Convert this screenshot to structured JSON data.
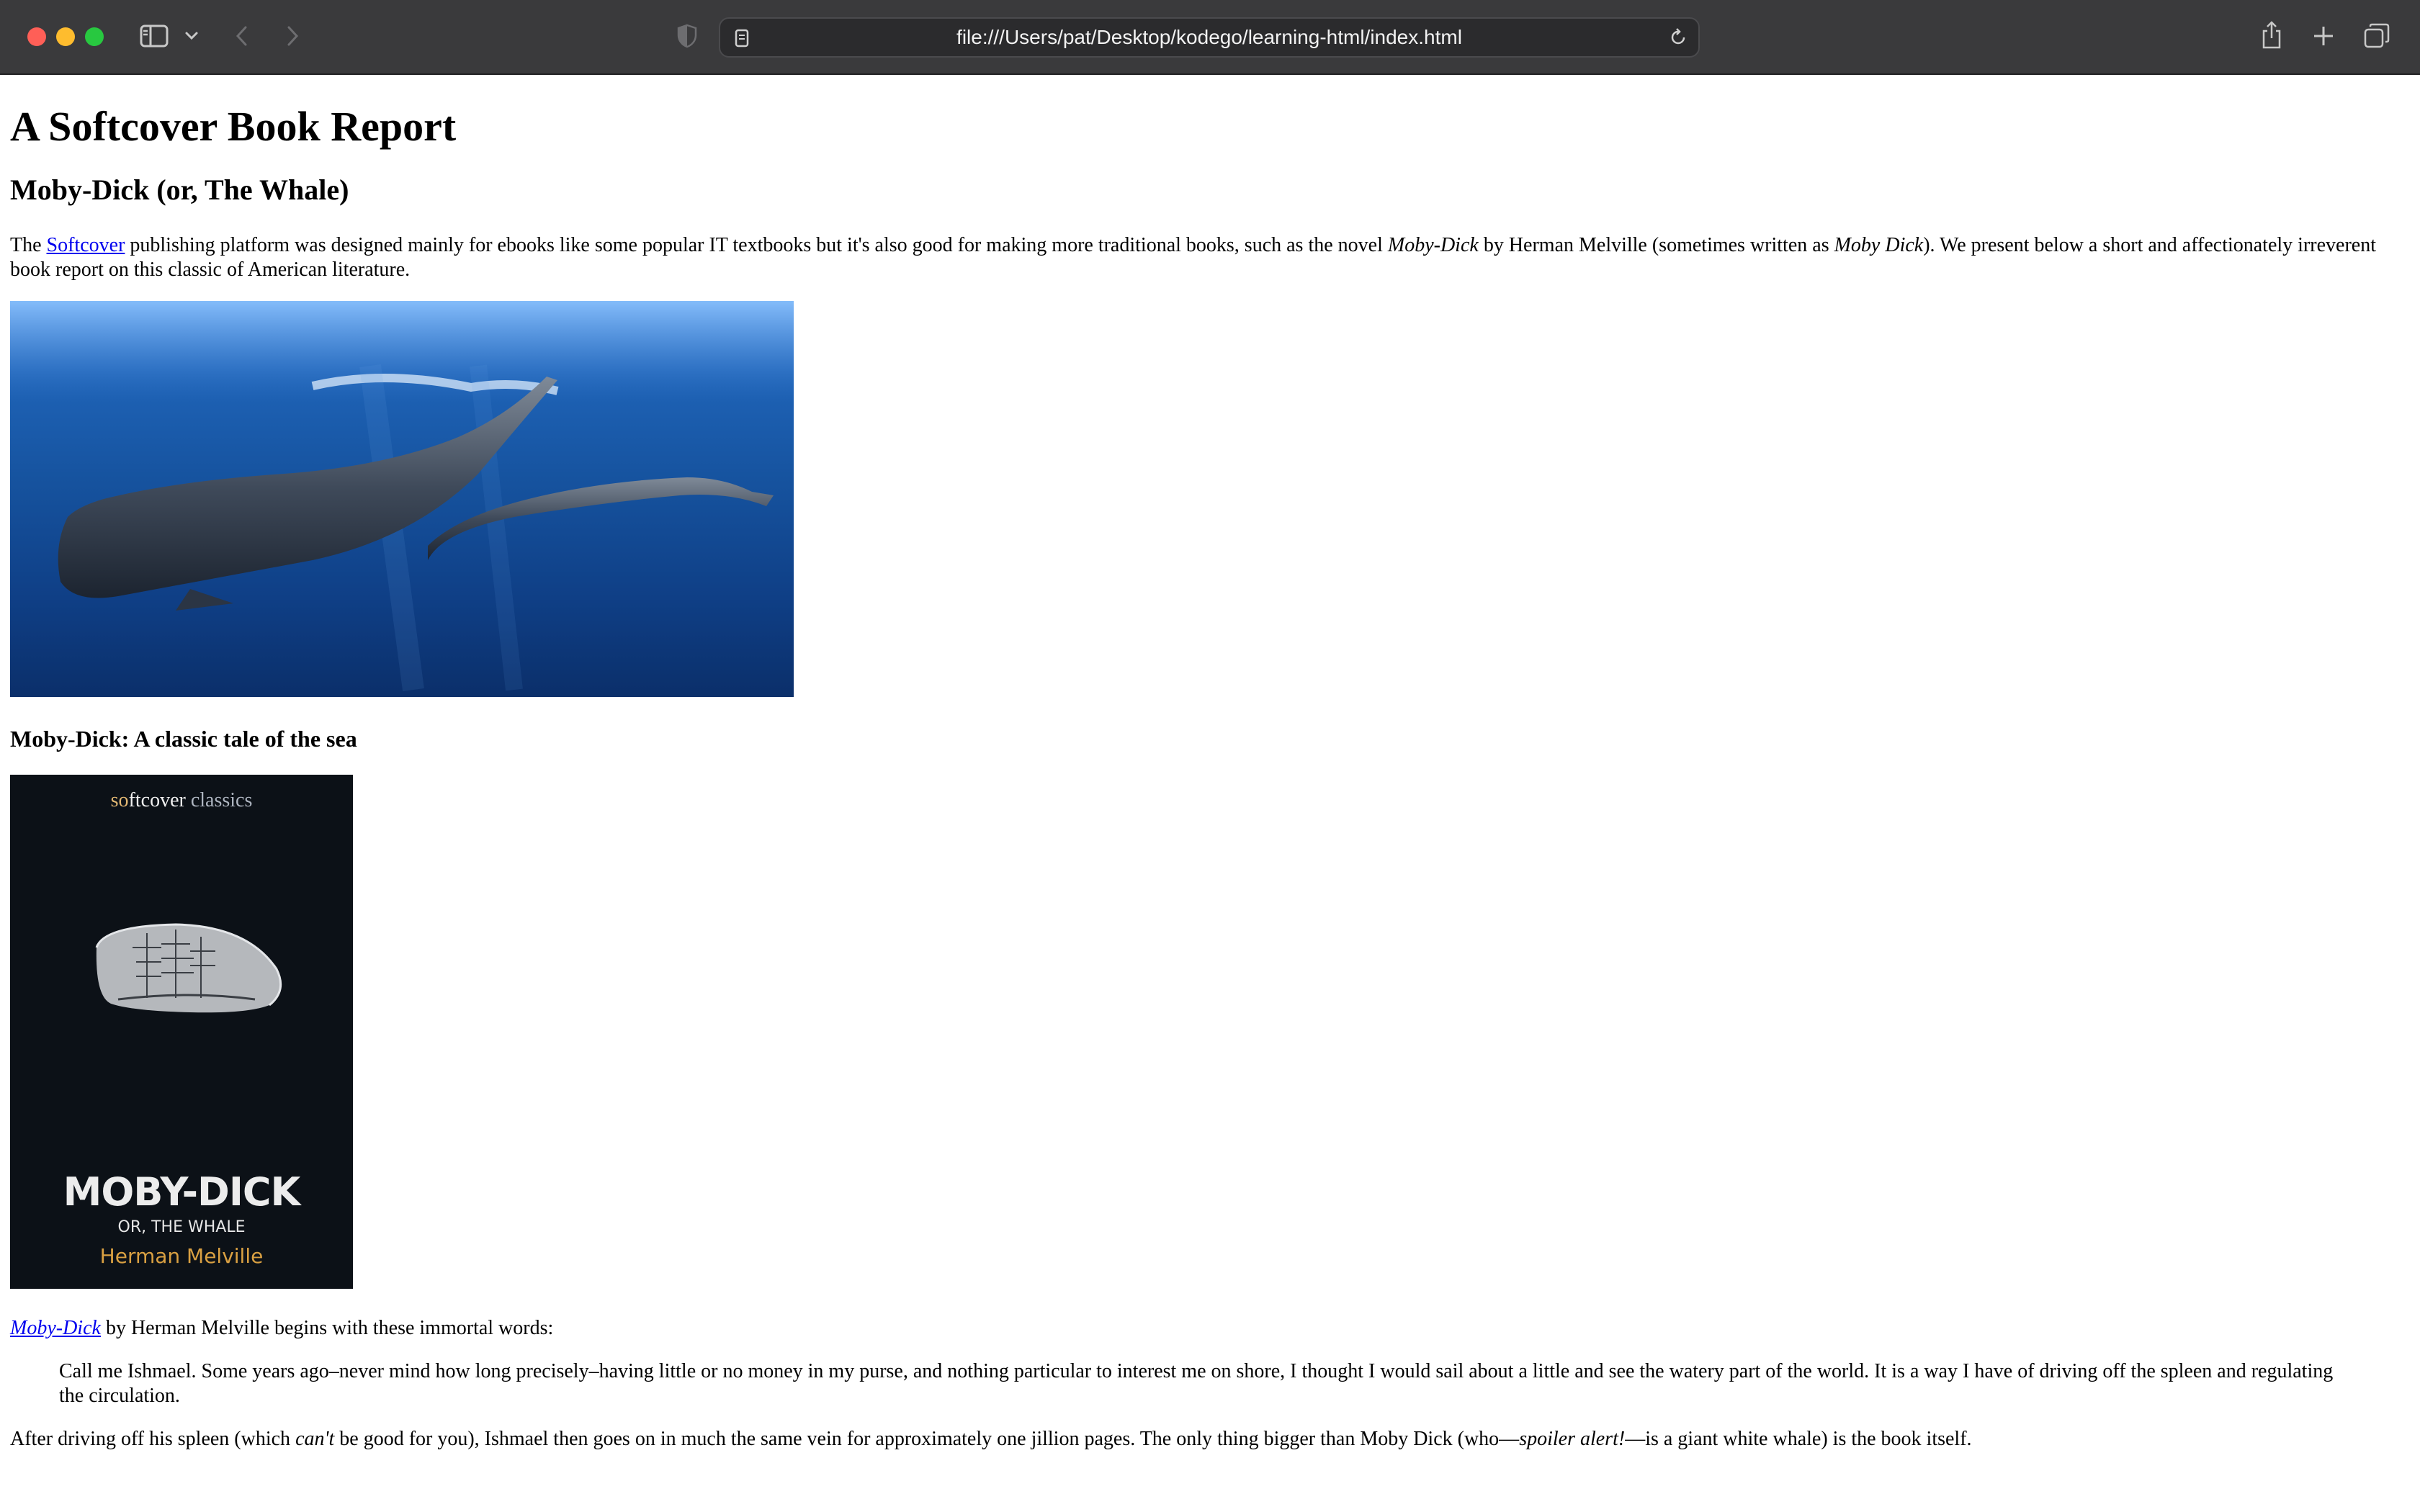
{
  "browser": {
    "url": "file:///Users/pat/Desktop/kodego/learning-html/index.html"
  },
  "page": {
    "title": "A Softcover Book Report",
    "book_heading": "Moby-Dick (or, The Whale)",
    "intro": {
      "before_link": "The ",
      "link": "Softcover",
      "after_link": " publishing platform was designed mainly for ebooks like some popular IT textbooks but it's also good for making more traditional books, such as the novel ",
      "novel_italic": "Moby-Dick",
      "mid": " by Herman Melville (sometimes written as ",
      "alt_italic": "Moby Dick",
      "end": "). We present below a short and affectionately irreverent book report on this classic of American literature."
    },
    "caption_heading": "Moby-Dick: A classic tale of the sea",
    "cover": {
      "brand_so": "so",
      "brand_ftcover": "ftcover",
      "brand_classics": " classics",
      "title": "MOBY-DICK",
      "subtitle": "OR, THE WHALE",
      "author": "Herman Melville"
    },
    "opening": {
      "link": "Moby-Dick",
      "text": " by Herman Melville begins with these immortal words:"
    },
    "quote": "Call me Ishmael. Some years ago–never mind how long precisely–having little or no money in my purse, and nothing particular to interest me on shore, I thought I would sail about a little and see the watery part of the world. It is a way I have of driving off the spleen and regulating the circulation.",
    "closing": {
      "p1": "After driving off his spleen (which ",
      "cant": "can't",
      "p2": " be good for you), Ishmael then goes on in much the same vein for approximately one jillion pages. The only thing bigger than Moby Dick (who—",
      "spoiler": "spoiler alert!",
      "p3": "—is a giant white whale) is the book itself."
    }
  },
  "colors": {
    "toolbar": "#3a3a3c",
    "link": "#0000ee",
    "cover_bg": "#0c1117",
    "author_gold": "#d9a042"
  }
}
